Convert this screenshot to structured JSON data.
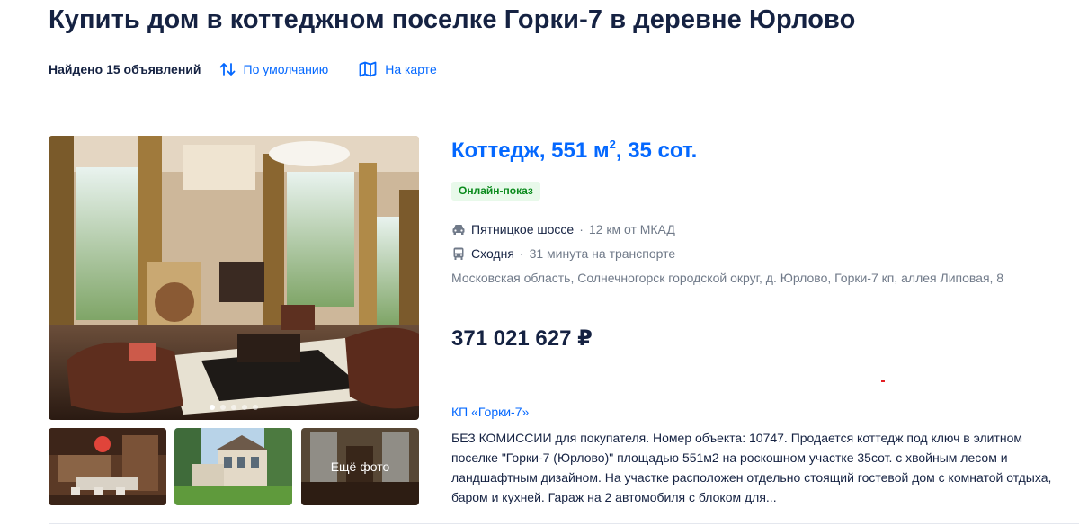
{
  "page": {
    "title": "Купить дом в коттеджном поселке Горки-7 в деревне Юрлово"
  },
  "toolbar": {
    "found_text": "Найдено 15 объявлений",
    "sort_label": "По умолчанию",
    "sort_icon": "sort-arrows-icon",
    "map_label": "На карте",
    "map_icon": "map-icon"
  },
  "listing": {
    "title_main": "Коттедж, 551 м",
    "title_sup": "2",
    "title_rest": ", 35 сот.",
    "badge": "Онлайн-показ",
    "highway": {
      "icon": "car-icon",
      "name": "Пятницкое шоссе",
      "separator": "·",
      "distance": "12 км от МКАД"
    },
    "transit": {
      "icon": "bus-icon",
      "name": "Сходня",
      "separator": "·",
      "time": "31 минута на транспорте"
    },
    "address": "Московская область, Солнечногорск городской округ, д. Юрлово, Горки-7 кп, аллея Липовая, 8",
    "price": "371 021 627 ₽",
    "jk": "КП «Горки-7»",
    "description": "БЕЗ КОМИССИИ для покупателя. Номер объекта: 10747. Продается коттедж под ключ в элитном поселке \"Горки-7 (Юрлово)\" площадью 551м2 на роскошном участке 35сот. с хвойным лесом и ландшафтным дизайном. На участке расположен отдельно стоящий гостевой дом с комнатой отдыха, баром и кухней. Гараж на 2 автомобиля с блоком для..."
  },
  "gallery": {
    "main_photo": "living-room-photo",
    "dots_total": 5,
    "dots_active": 1,
    "thumbs": [
      "kitchen-photo",
      "house-exterior-photo",
      "interior-photo"
    ],
    "more_label": "Ещё фото"
  },
  "colors": {
    "title": "#152242",
    "link": "#0468ff",
    "muted": "#707a89",
    "badge_bg": "#e8f9ea",
    "badge_text": "#0a8a1c"
  }
}
